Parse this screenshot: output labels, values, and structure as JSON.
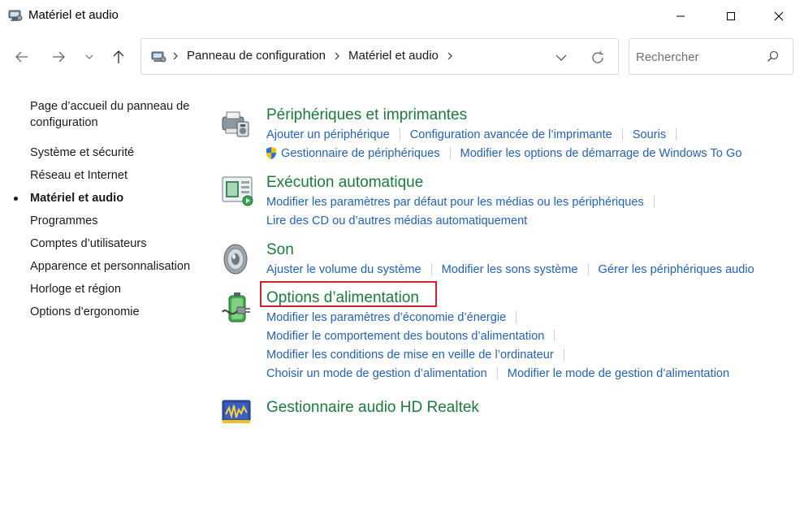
{
  "window": {
    "title": "Matériel et audio"
  },
  "address_bar": {
    "crumbs": [
      "Panneau de configuration",
      "Matériel et audio"
    ]
  },
  "search": {
    "placeholder": "Rechercher"
  },
  "sidebar": {
    "items": [
      {
        "label": "Page d’accueil du panneau de configuration"
      },
      {
        "label": "Système et sécurité"
      },
      {
        "label": "Réseau et Internet"
      },
      {
        "label": "Matériel et audio"
      },
      {
        "label": "Programmes"
      },
      {
        "label": "Comptes d’utilisateurs"
      },
      {
        "label": "Apparence et personnalisation"
      },
      {
        "label": "Horloge et région"
      },
      {
        "label": "Options d’ergonomie"
      }
    ]
  },
  "categories": {
    "devices": {
      "title": "Périphériques et imprimantes",
      "links": [
        "Ajouter un périphérique",
        "Configuration avancée de l’imprimante",
        "Souris",
        "Gestionnaire de périphériques",
        "Modifier les options de démarrage de Windows To Go"
      ]
    },
    "autoplay": {
      "title": "Exécution automatique",
      "links": [
        "Modifier les paramètres par défaut pour les médias ou les périphériques",
        "Lire des CD ou d’autres médias automatiquement"
      ]
    },
    "sound": {
      "title": "Son",
      "links": [
        "Ajuster le volume du système",
        "Modifier les sons système",
        "Gérer les périphériques audio"
      ]
    },
    "power": {
      "title": "Options d’alimentation",
      "links": [
        "Modifier les paramètres d’économie d’énergie",
        "Modifier le comportement des boutons d’alimentation",
        "Modifier les conditions de mise en veille de l’ordinateur",
        "Choisir un mode de gestion d’alimentation",
        "Modifier le mode de gestion d’alimentation"
      ]
    },
    "realtek": {
      "title": "Gestionnaire audio HD Realtek"
    }
  },
  "colors": {
    "category_title": "#1e7a3c",
    "link": "#2462b3",
    "highlight_border": "#d0202a"
  }
}
